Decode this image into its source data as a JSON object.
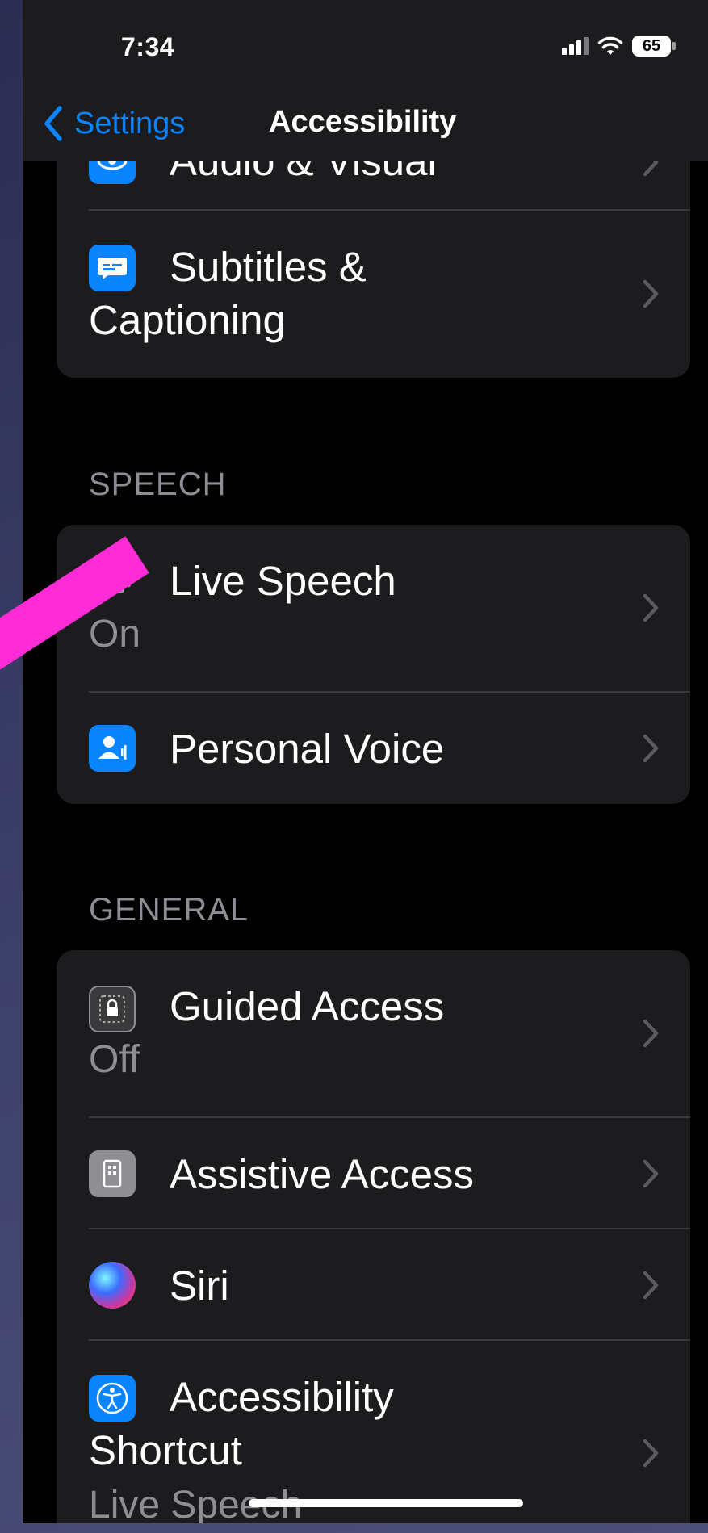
{
  "status_bar": {
    "time": "7:34",
    "battery": "65"
  },
  "nav": {
    "back_label": "Settings",
    "title": "Accessibility"
  },
  "vision_section": {
    "partial_row_label": "Audio & Visual",
    "subtitles_label_line1": "Subtitles &",
    "subtitles_label_line2": "Captioning"
  },
  "speech_section": {
    "header": "SPEECH",
    "live_speech": {
      "label": "Live Speech",
      "value": "On"
    },
    "personal_voice": {
      "label": "Personal Voice"
    }
  },
  "general_section": {
    "header": "GENERAL",
    "guided_access": {
      "label": "Guided Access",
      "value": "Off"
    },
    "assistive_access": {
      "label": "Assistive Access"
    },
    "siri": {
      "label": "Siri"
    },
    "accessibility_shortcut": {
      "label_line1": "Accessibility",
      "label_line2": "Shortcut",
      "value": "Live Speech"
    }
  },
  "colors": {
    "accent": "#0a84ff",
    "annotation_arrow": "#ff2bd6"
  },
  "icons": [
    "chevron-left-icon",
    "eye-icon",
    "subtitles-icon",
    "keyboard-speech-icon",
    "personal-voice-icon",
    "guided-access-lock-icon",
    "assistive-access-icon",
    "siri-icon",
    "accessibility-icon",
    "chevron-right-icon"
  ]
}
